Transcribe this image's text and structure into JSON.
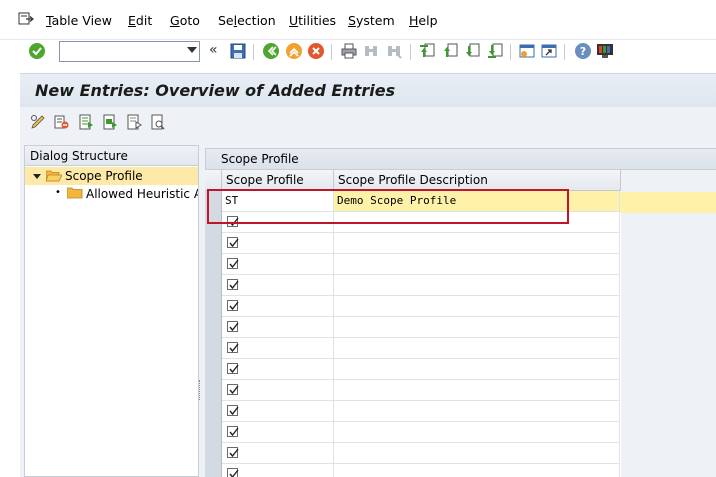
{
  "menu": {
    "items": [
      {
        "label": "Table View",
        "u": "T",
        "rest": "able View"
      },
      {
        "label": "Edit",
        "u": "E",
        "rest": "dit"
      },
      {
        "label": "Goto",
        "u": "G",
        "rest": "oto"
      },
      {
        "label": "Selection",
        "u": "l",
        "pre": "Se",
        "rest": "ection"
      },
      {
        "label": "Utilities",
        "u": "U",
        "rest": "tilities"
      },
      {
        "label": "System",
        "u": "S",
        "rest": "ystem"
      },
      {
        "label": "Help",
        "u": "H",
        "rest": "elp"
      }
    ]
  },
  "toolbar": {
    "command_value": "",
    "icons": [
      "enter-icon",
      "command-dropdown",
      "back-chevron-icon",
      "save-icon",
      "back-icon",
      "exit-icon",
      "cancel-icon",
      "print-icon",
      "find-icon",
      "find-next-icon",
      "first-page-icon",
      "previous-page-icon",
      "next-page-icon",
      "last-page-icon",
      "create-session-icon",
      "shortcut-icon",
      "help-icon",
      "layout-icon"
    ]
  },
  "title": "New Entries: Overview of Added Entries",
  "app_toolbar": {
    "icons": [
      "change-display-icon",
      "delete-icon",
      "select-all-icon",
      "select-block-icon",
      "deselect-all-icon",
      "choose-icon"
    ]
  },
  "dialog_structure": {
    "header": "Dialog Structure",
    "items": [
      {
        "label": "Scope Profile",
        "selected": true,
        "level": 0,
        "expanded": true
      },
      {
        "label": "Allowed Heuristic Alg",
        "selected": false,
        "level": 1
      }
    ]
  },
  "table": {
    "title": "Scope Profile",
    "columns": [
      "Scope Profile",
      "Scope Profile Description"
    ],
    "rows": [
      {
        "profile": "ST",
        "description": "Demo Scope Profile"
      },
      {
        "profile": "",
        "description": ""
      },
      {
        "profile": "",
        "description": ""
      },
      {
        "profile": "",
        "description": ""
      },
      {
        "profile": "",
        "description": ""
      },
      {
        "profile": "",
        "description": ""
      },
      {
        "profile": "",
        "description": ""
      },
      {
        "profile": "",
        "description": ""
      },
      {
        "profile": "",
        "description": ""
      },
      {
        "profile": "",
        "description": ""
      },
      {
        "profile": "",
        "description": ""
      },
      {
        "profile": "",
        "description": ""
      },
      {
        "profile": "",
        "description": ""
      },
      {
        "profile": "",
        "description": ""
      }
    ]
  },
  "colors": {
    "highlight_border": "#c0152a",
    "selected_tree_bg": "#ffe9a8",
    "input_yellow": "#fdf2a8",
    "panel_bg": "#eef2f6"
  }
}
